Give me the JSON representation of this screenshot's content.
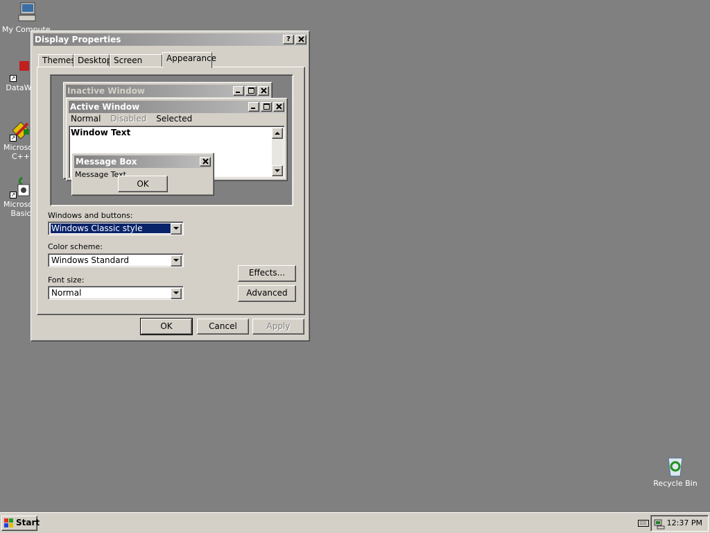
{
  "desktop": {
    "icons": [
      {
        "label": "My Computer"
      },
      {
        "label": "DataWa"
      },
      {
        "label": "Microsoft\nC++"
      },
      {
        "label": "Microsoft\nBasic"
      },
      {
        "label": "Recycle Bin"
      }
    ]
  },
  "dialog": {
    "title": "Display Properties",
    "help_btn": "?",
    "tabs": [
      {
        "label": "Themes"
      },
      {
        "label": "Desktop"
      },
      {
        "label": "Screen Saver"
      },
      {
        "label": "Appearance",
        "selected": true
      }
    ],
    "preview": {
      "inactive_title": "Inactive Window",
      "active_title": "Active Window",
      "menu": [
        "Normal",
        "Disabled",
        "Selected"
      ],
      "window_text": "Window Text",
      "msgbox_title": "Message Box",
      "msgbox_text": "Message Text",
      "msgbox_ok": "OK"
    },
    "windows_buttons_label": "Windows and buttons:",
    "windows_buttons_value": "Windows Classic style",
    "color_scheme_label": "Color scheme:",
    "color_scheme_value": "Windows Standard",
    "font_size_label": "Font size:",
    "font_size_value": "Normal",
    "effects_btn": "Effects...",
    "advanced_btn": "Advanced",
    "ok_btn": "OK",
    "cancel_btn": "Cancel",
    "apply_btn": "Apply"
  },
  "taskbar": {
    "start_label": "Start",
    "clock": "12:37 PM"
  },
  "colors": {
    "desktop": "#808080",
    "face": "#d4d0c8",
    "selection": "#0a246a"
  }
}
